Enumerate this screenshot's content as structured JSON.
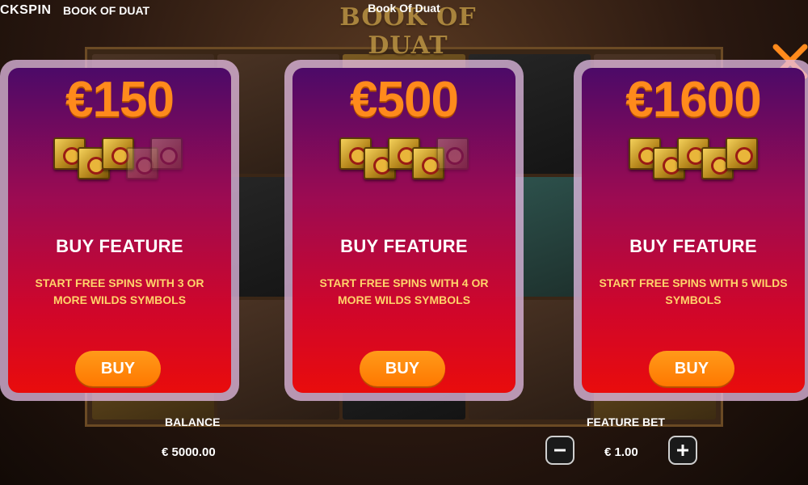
{
  "header": {
    "brand": "CKSPIN",
    "game_name_small": "BOOK OF DUAT",
    "window_title": "Book Of Duat",
    "logo_text": "BOOK OF DUAT"
  },
  "close_icon": "close-icon",
  "cards": [
    {
      "price": "€150",
      "books_highlighted": 3,
      "books_total": 5,
      "heading": "BUY FEATURE",
      "description": "START FREE SPINS WITH 3 OR MORE WILDS SYMBOLS",
      "button_label": "BUY"
    },
    {
      "price": "€500",
      "books_highlighted": 4,
      "books_total": 5,
      "heading": "BUY FEATURE",
      "description": "START FREE SPINS WITH 4 OR MORE WILDS SYMBOLS",
      "button_label": "BUY"
    },
    {
      "price": "€1600",
      "books_highlighted": 5,
      "books_total": 5,
      "heading": "BUY FEATURE",
      "description": "START FREE SPINS WITH 5 WILDS SYMBOLS",
      "button_label": "BUY"
    }
  ],
  "footer": {
    "balance_label": "BALANCE",
    "balance_value": "€ 5000.00",
    "feature_bet_label": "FEATURE BET",
    "feature_bet_value": "€ 1.00",
    "minus_icon": "minus-icon",
    "plus_icon": "plus-icon"
  },
  "colors": {
    "price": "#ff8a1c",
    "description": "#ffd36a",
    "button": "#ff7800",
    "close": "#ff8a1c",
    "card_top": "#4c0a68",
    "card_bottom": "#e90c0c"
  }
}
